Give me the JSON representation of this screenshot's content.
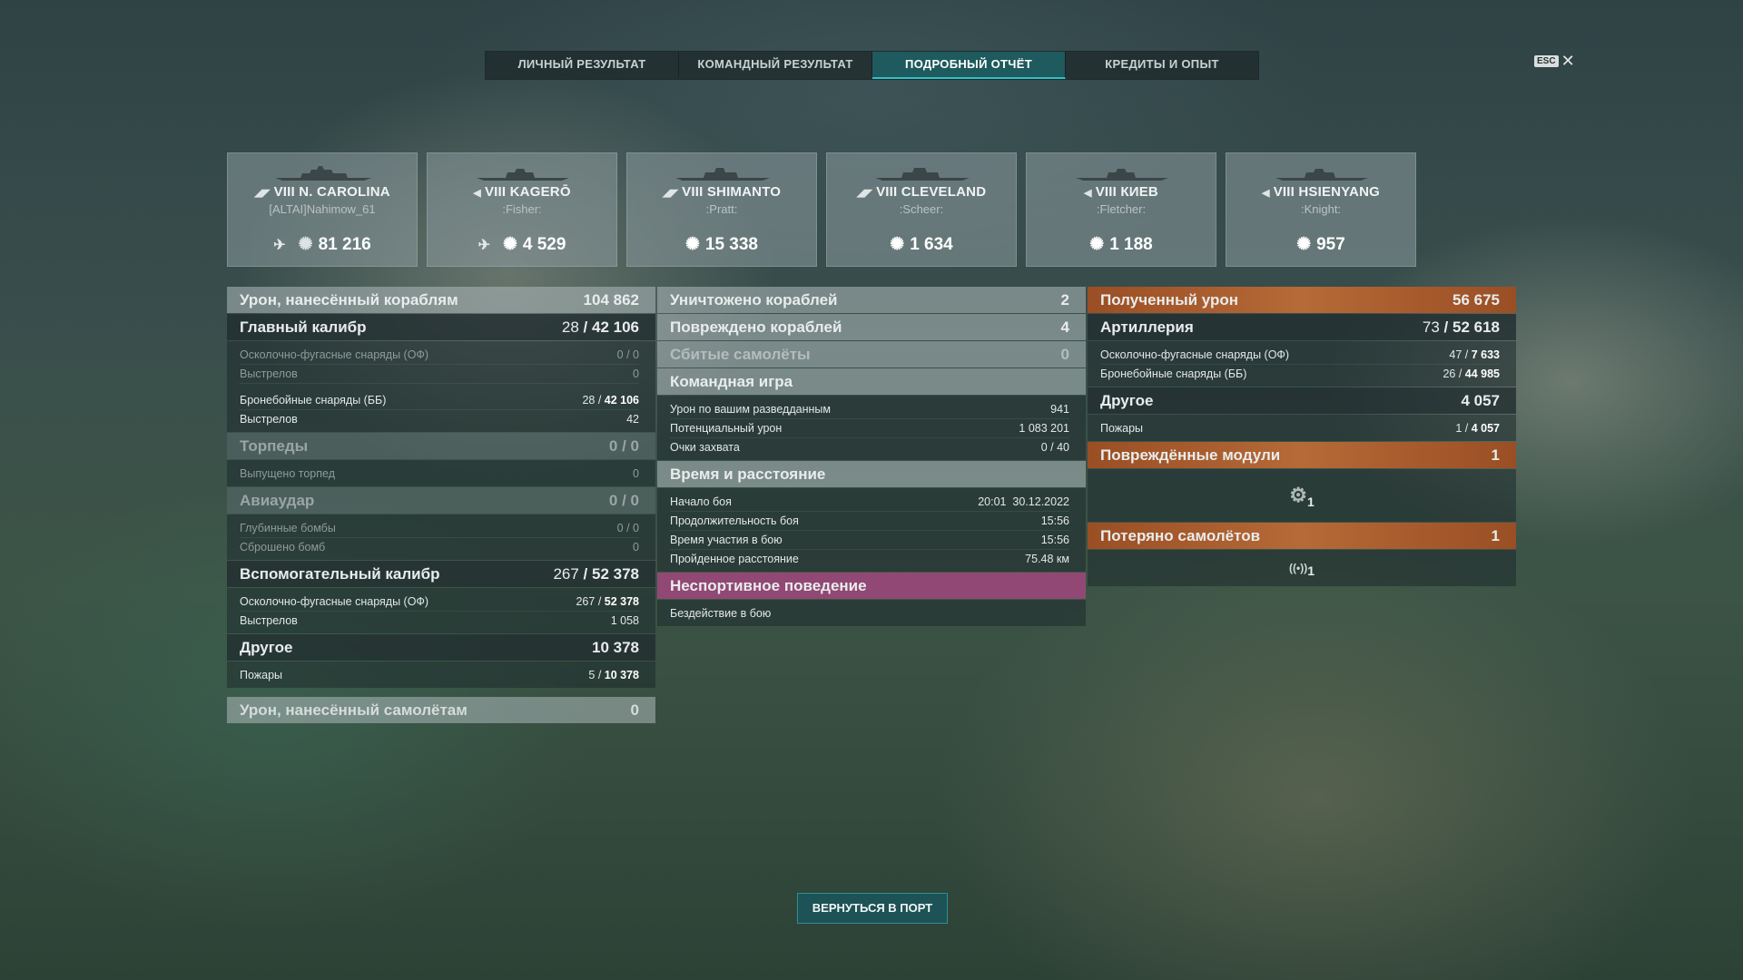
{
  "tabs": [
    {
      "label": "ЛИЧНЫЙ РЕЗУЛЬТАТ",
      "active": false
    },
    {
      "label": "КОМАНДНЫЙ РЕЗУЛЬТАТ",
      "active": false
    },
    {
      "label": "ПОДРОБНЫЙ ОТЧЁТ",
      "active": true
    },
    {
      "label": "КРЕДИТЫ И ОПЫТ",
      "active": false
    }
  ],
  "esc": {
    "key": "ESC",
    "close": "✕"
  },
  "ships": [
    {
      "name": "VIII N. CAROLINA",
      "player": "[ALTAI]Nahimow_61",
      "score": "81 216",
      "plane_icon": true
    },
    {
      "name": "VIII KAGERŌ",
      "player": ":Fisher:",
      "score": "4 529",
      "plane_icon": true
    },
    {
      "name": "VIII SHIMANTO",
      "player": ":Pratt:",
      "score": "15 338",
      "plane_icon": false
    },
    {
      "name": "VIII CLEVELAND",
      "player": ":Scheer:",
      "score": "1 634",
      "plane_icon": false
    },
    {
      "name": "VIII КИЕВ",
      "player": ":Fletcher:",
      "score": "1 188",
      "plane_icon": false
    },
    {
      "name": "VIII HSIENYANG",
      "player": ":Knight:",
      "score": "957",
      "plane_icon": false
    }
  ],
  "col1": {
    "damage": {
      "label": "Урон, нанесённый кораблям",
      "value": "104 862"
    },
    "main": {
      "label": "Главный калибр",
      "hits": "28",
      "total": "42 106",
      "he": {
        "label": "Осколочно-фугасные снаряды (ОФ)",
        "value": "0 / 0"
      },
      "he_shots": {
        "label": "Выстрелов",
        "value": "0"
      },
      "ap": {
        "label": "Бронебойные снаряды (ББ)",
        "hits": "28",
        "total": "42 106"
      },
      "ap_shots": {
        "label": "Выстрелов",
        "value": "42"
      }
    },
    "torp": {
      "label": "Торпеды",
      "value": "0 / 0",
      "row": {
        "label": "Выпущено торпед",
        "value": "0"
      }
    },
    "air": {
      "label": "Авиаудар",
      "value": "0 / 0",
      "depth": {
        "label": "Глубинные бомбы",
        "value": "0 / 0"
      },
      "bombs": {
        "label": "Сброшено бомб",
        "value": "0"
      }
    },
    "sec": {
      "label": "Вспомогательный калибр",
      "hits": "267",
      "total": "52 378",
      "he": {
        "label": "Осколочно-фугасные снаряды (ОФ)",
        "hits": "267",
        "total": "52 378"
      },
      "shots": {
        "label": "Выстрелов",
        "value": "1 058"
      }
    },
    "other": {
      "label": "Другое",
      "value": "10 378",
      "fires": {
        "label": "Пожары",
        "hits": "5",
        "total": "10 378"
      }
    },
    "planes": {
      "label": "Урон, нанесённый самолётам",
      "value": "0"
    }
  },
  "col2": {
    "destroyed": {
      "label": "Уничтожено кораблей",
      "value": "2"
    },
    "damaged": {
      "label": "Повреждено кораблей",
      "value": "4"
    },
    "planes": {
      "label": "Сбитые самолёты",
      "value": "0"
    },
    "team": {
      "label": "Командная игра",
      "spot": {
        "label": "Урон по вашим разведданным",
        "value": "941"
      },
      "potential": {
        "label": "Потенциальный урон",
        "value": "1 083 201"
      },
      "capture": {
        "label": "Очки захвата",
        "value": "0 / 40"
      }
    },
    "time": {
      "label": "Время и расстояние",
      "start": {
        "label": "Начало боя",
        "value": "20:01  30.12.2022"
      },
      "duration": {
        "label": "Продолжительность боя",
        "value": "15:56"
      },
      "participation": {
        "label": "Время участия в бою",
        "value": "15:56"
      },
      "distance": {
        "label": "Пройденное расстояние",
        "value": "75.48 км"
      }
    },
    "unsport": {
      "label": "Неспортивное поведение",
      "row": "Бездействие в бою"
    }
  },
  "col3": {
    "received": {
      "label": "Полученный урон",
      "value": "56 675"
    },
    "artillery": {
      "label": "Артиллерия",
      "hits": "73",
      "total": "52 618",
      "he": {
        "label": "Осколочно-фугасные снаряды (ОФ)",
        "hits": "47",
        "total": "7 633"
      },
      "ap": {
        "label": "Бронебойные снаряды (ББ)",
        "hits": "26",
        "total": "44 985"
      }
    },
    "other": {
      "label": "Другое",
      "value": "4 057",
      "fires": {
        "label": "Пожары",
        "hits": "1",
        "total": "4 057"
      }
    },
    "modules": {
      "label": "Повреждённые модули",
      "value": "1",
      "icon": "module-icon",
      "count": "1"
    },
    "lost": {
      "label": "Потеряно самолётов",
      "value": "1",
      "icon": "radar-icon",
      "count": "1"
    }
  },
  "footer": {
    "return_label": "ВЕРНУТЬСЯ В ПОРТ"
  }
}
